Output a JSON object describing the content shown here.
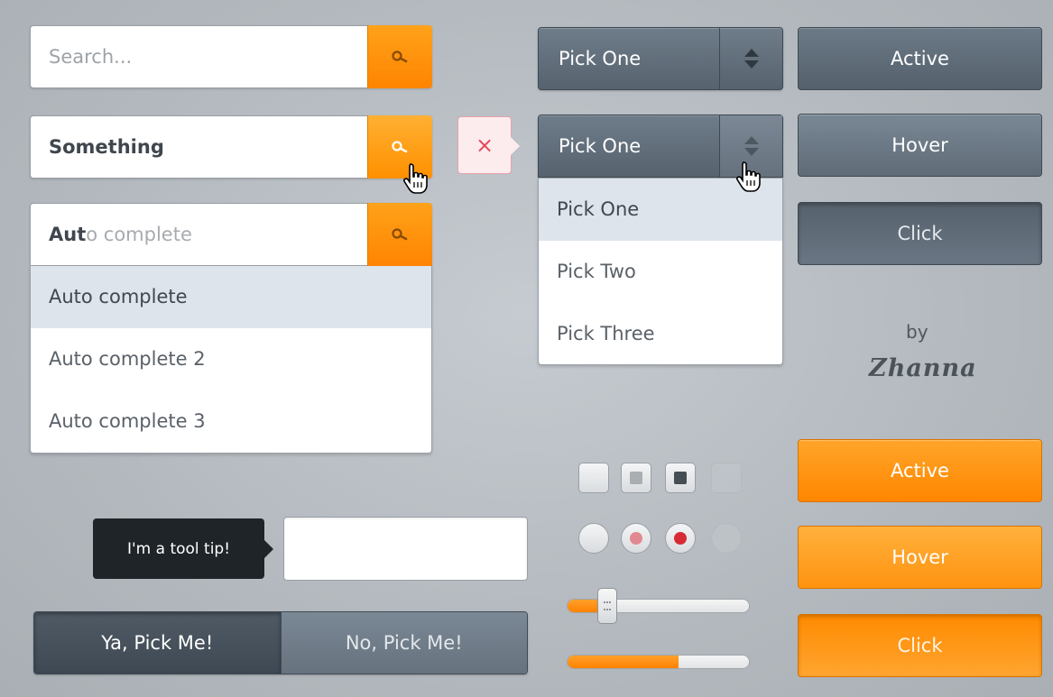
{
  "search": {
    "default_placeholder": "Search...",
    "filled_value": "Something",
    "autocomplete_typed": "Aut",
    "autocomplete_suggestion": "o complete",
    "autocomplete_options": [
      "Auto complete",
      "Auto complete 2",
      "Auto complete 3"
    ]
  },
  "select": {
    "closed_value": "Pick One",
    "open_value": "Pick One",
    "options": [
      "Pick One",
      "Pick Two",
      "Pick Three"
    ]
  },
  "error": {
    "icon": "close-icon",
    "symbol": "×"
  },
  "slate_buttons": {
    "active": "Active",
    "hover": "Hover",
    "click": "Click"
  },
  "orange_buttons": {
    "active": "Active",
    "hover": "Hover",
    "click": "Click"
  },
  "credit": {
    "by": "by",
    "author": "Zhanna"
  },
  "tooltip": {
    "text": "I'm a tool tip!"
  },
  "text_field": {
    "value": ""
  },
  "segmented": {
    "on": "Ya, Pick Me!",
    "off": "No, Pick Me!"
  },
  "checkboxes": [
    "unchecked",
    "hover",
    "checked",
    "disabled"
  ],
  "radios": [
    "unchecked",
    "hover",
    "checked",
    "disabled"
  ],
  "slider": {
    "value": 0.22
  },
  "progress": {
    "value": 0.61
  },
  "colors": {
    "accent": "#ff8a00",
    "slate": "#5f6c78",
    "error": "#e5475a",
    "radio_checked": "#d62b36",
    "radio_hover": "#e08a90"
  }
}
